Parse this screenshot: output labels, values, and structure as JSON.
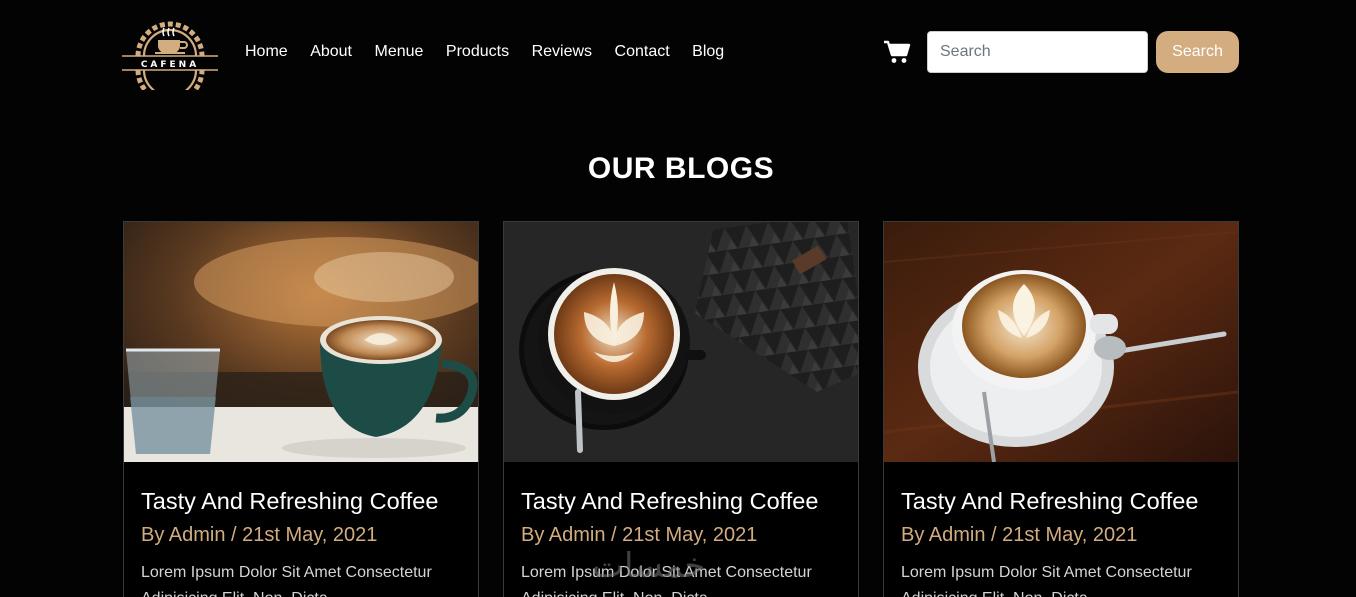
{
  "brand": {
    "logo_text": "CAFENA",
    "accent": "#d3ad7f"
  },
  "nav": {
    "items": [
      "Home",
      "About",
      "Menue",
      "Products",
      "Reviews",
      "Contact",
      "Blog"
    ]
  },
  "header": {
    "cart_icon": "shopping-cart-icon",
    "search_placeholder": "Search",
    "search_button": "Search"
  },
  "section": {
    "title": "OUR BLOGS"
  },
  "blogs": [
    {
      "title": "Tasty And Refreshing Coffee",
      "meta": "By Admin / 21st May, 2021",
      "excerpt": "Lorem Ipsum Dolor Sit Amet Consectetur Adipisicing Elit. Non, Dicta."
    },
    {
      "title": "Tasty And Refreshing Coffee",
      "meta": "By Admin / 21st May, 2021",
      "excerpt": "Lorem Ipsum Dolor Sit Amet Consectetur Adipisicing Elit. Non, Dicta."
    },
    {
      "title": "Tasty And Refreshing Coffee",
      "meta": "By Admin / 21st May, 2021",
      "excerpt": "Lorem Ipsum Dolor Sit Amet Consectetur Adipisicing Elit. Non, Dicta."
    }
  ],
  "watermark": "خمسات"
}
